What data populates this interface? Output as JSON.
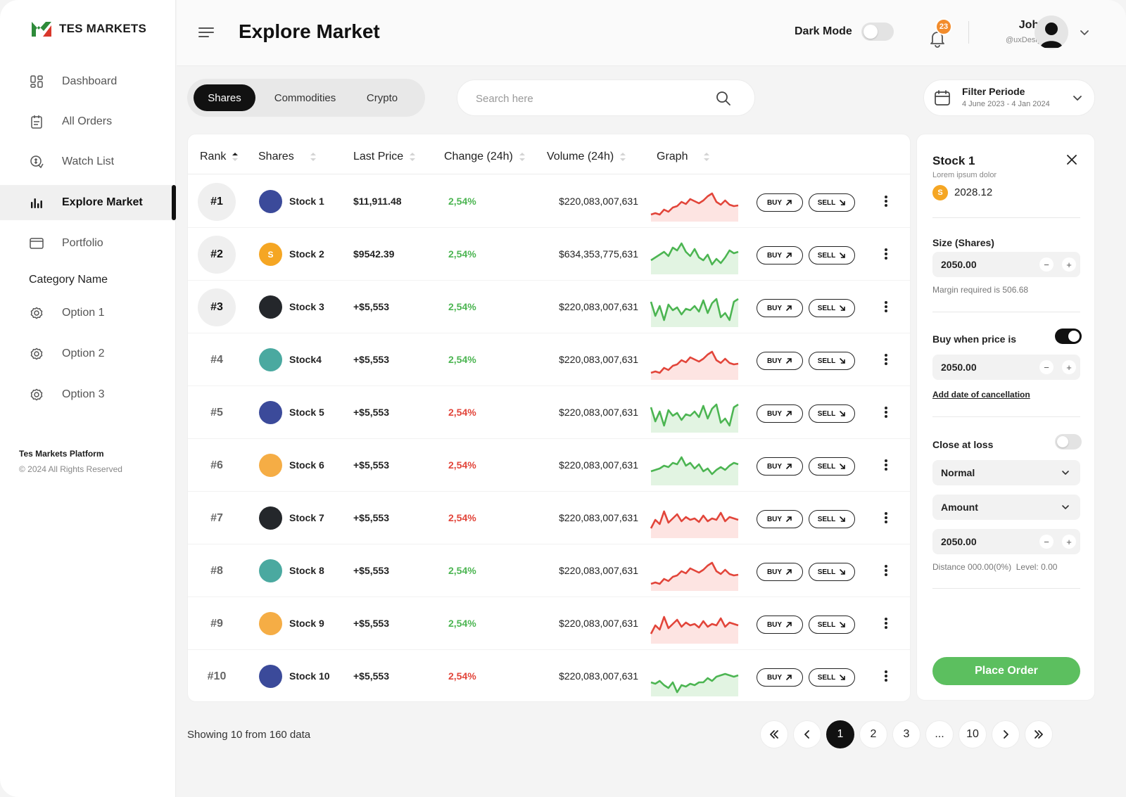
{
  "brand": {
    "name": "TES MARKETS"
  },
  "sidebar": {
    "items": [
      {
        "label": "Dashboard",
        "icon": "dashboard-icon"
      },
      {
        "label": "All Orders",
        "icon": "clipboard-icon"
      },
      {
        "label": "Watch List",
        "icon": "watchlist-icon"
      },
      {
        "label": "Explore Market",
        "icon": "bar-chart-icon",
        "active": true
      },
      {
        "label": "Portfolio",
        "icon": "folder-icon"
      }
    ],
    "category_name": "Category Name",
    "options": [
      {
        "label": "Option 1",
        "icon": "gear-icon"
      },
      {
        "label": "Option 2",
        "icon": "gear-icon"
      },
      {
        "label": "Option 3",
        "icon": "gear-icon"
      }
    ],
    "footer_title": "Tes Markets Platform",
    "footer_copy": "© 2024 All Rights Reserved"
  },
  "header": {
    "title": "Explore Market",
    "dark_mode_label": "Dark Mode",
    "dark_mode_on": false,
    "notification_count": "23",
    "user_name": "John",
    "user_handle": "@uxDesign"
  },
  "toolbar": {
    "tabs": [
      "Shares",
      "Commodities",
      "Crypto"
    ],
    "active_tab": "Shares",
    "search_placeholder": "Search here",
    "filter_label": "Filter Periode",
    "filter_range": "4 June 2023 - 4 Jan 2024"
  },
  "table": {
    "columns": [
      "Rank",
      "Shares",
      "Last Price",
      "Change (24h)",
      "Volume (24h)",
      "Graph"
    ],
    "buy_label": "BUY",
    "sell_label": "SELL",
    "rows": [
      {
        "rank": "#1",
        "name": "Stock 1",
        "price": "$11,911.48",
        "change": "2,54%",
        "trend": "up",
        "volume": "$220,083,007,631",
        "coin_color": "#3b4a9a",
        "coin_letter": "",
        "graph": "red-a"
      },
      {
        "rank": "#2",
        "name": "Stock 2",
        "price": "$9542.39",
        "change": "2,54%",
        "trend": "up",
        "volume": "$634,353,775,631",
        "coin_color": "#f5a623",
        "coin_letter": "S",
        "graph": "green-a"
      },
      {
        "rank": "#3",
        "name": "Stock 3",
        "price": "+$5,553",
        "change": "2,54%",
        "trend": "up",
        "volume": "$220,083,007,631",
        "coin_color": "#24272b",
        "coin_letter": "",
        "graph": "green-b"
      },
      {
        "rank": "#4",
        "name": "Stock4",
        "price": "+$5,553",
        "change": "2,54%",
        "trend": "up",
        "volume": "$220,083,007,631",
        "coin_color": "#4aa9a0",
        "coin_letter": "",
        "graph": "red-a"
      },
      {
        "rank": "#5",
        "name": "Stock 5",
        "price": "+$5,553",
        "change": "2,54%",
        "trend": "down",
        "volume": "$220,083,007,631",
        "coin_color": "#3b4a9a",
        "coin_letter": "",
        "graph": "green-b"
      },
      {
        "rank": "#6",
        "name": "Stock 6",
        "price": "+$5,553",
        "change": "2,54%",
        "trend": "down",
        "volume": "$220,083,007,631",
        "coin_color": "#f5ad45",
        "coin_letter": "",
        "graph": "green-c"
      },
      {
        "rank": "#7",
        "name": "Stock 7",
        "price": "+$5,553",
        "change": "2,54%",
        "trend": "down",
        "volume": "$220,083,007,631",
        "coin_color": "#24272b",
        "coin_letter": "",
        "graph": "red-b"
      },
      {
        "rank": "#8",
        "name": "Stock 8",
        "price": "+$5,553",
        "change": "2,54%",
        "trend": "up",
        "volume": "$220,083,007,631",
        "coin_color": "#4aa9a0",
        "coin_letter": "",
        "graph": "red-a"
      },
      {
        "rank": "#9",
        "name": "Stock 9",
        "price": "+$5,553",
        "change": "2,54%",
        "trend": "up",
        "volume": "$220,083,007,631",
        "coin_color": "#f5ad45",
        "coin_letter": "",
        "graph": "red-b"
      },
      {
        "rank": "#10",
        "name": "Stock 10",
        "price": "+$5,553",
        "change": "2,54%",
        "trend": "down",
        "volume": "$220,083,007,631",
        "coin_color": "#3b4a9a",
        "coin_letter": "",
        "graph": "green-d"
      }
    ]
  },
  "order_panel": {
    "title": "Stock 1",
    "subtitle": "Lorem ipsum dolor",
    "coin_letter": "S",
    "price": "2028.12",
    "size_label": "Size (Shares)",
    "size_value": "2050.00",
    "margin_note": "Margin required is 506.68",
    "buy_when_label": "Buy when price is",
    "buy_when_on": true,
    "buy_when_value": "2050.00",
    "add_date_link": "Add date of cancellation",
    "close_loss_label": "Close at loss",
    "close_loss_on": false,
    "mode_select": "Normal",
    "amount_select": "Amount",
    "amount_value": "2050.00",
    "distance_note": "Distance 000.00(0%)  Level: 0.00",
    "place_order": "Place Order"
  },
  "pagination": {
    "showing": "Showing 10 from 160 data",
    "pages": [
      "1",
      "2",
      "3",
      "...",
      "10"
    ],
    "current": "1"
  },
  "colors": {
    "up": "#4cb552",
    "down": "#e2453a",
    "accent": "#5cbf5f",
    "badge": "#f28c2c"
  }
}
